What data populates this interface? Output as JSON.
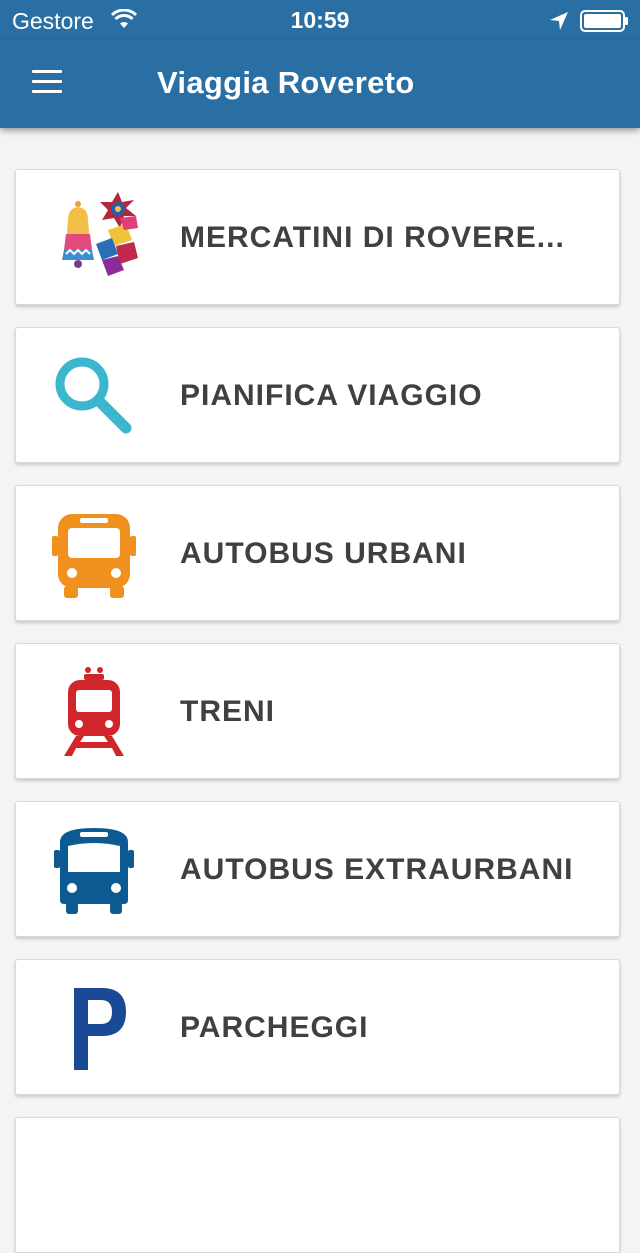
{
  "status_bar": {
    "carrier": "Gestore",
    "time": "10:59"
  },
  "header": {
    "title": "Viaggia Rovereto"
  },
  "menu": {
    "items": [
      {
        "label": "MERCATINI DI ROVERE...",
        "icon": "christmas-market-icon"
      },
      {
        "label": "PIANIFICA VIAGGIO",
        "icon": "search-icon",
        "color": "#3bb6cf"
      },
      {
        "label": "AUTOBUS URBANI",
        "icon": "bus-icon",
        "color": "#f0901f"
      },
      {
        "label": "TRENI",
        "icon": "train-icon",
        "color": "#d0262b"
      },
      {
        "label": "AUTOBUS EXTRAURBANI",
        "icon": "coach-icon",
        "color": "#0d5a92"
      },
      {
        "label": "PARCHEGGI",
        "icon": "parking-icon",
        "color": "#1a4a95"
      }
    ]
  },
  "colors": {
    "header": "#2a6fa3",
    "background": "#f4f4f4",
    "label_text": "#404040"
  }
}
